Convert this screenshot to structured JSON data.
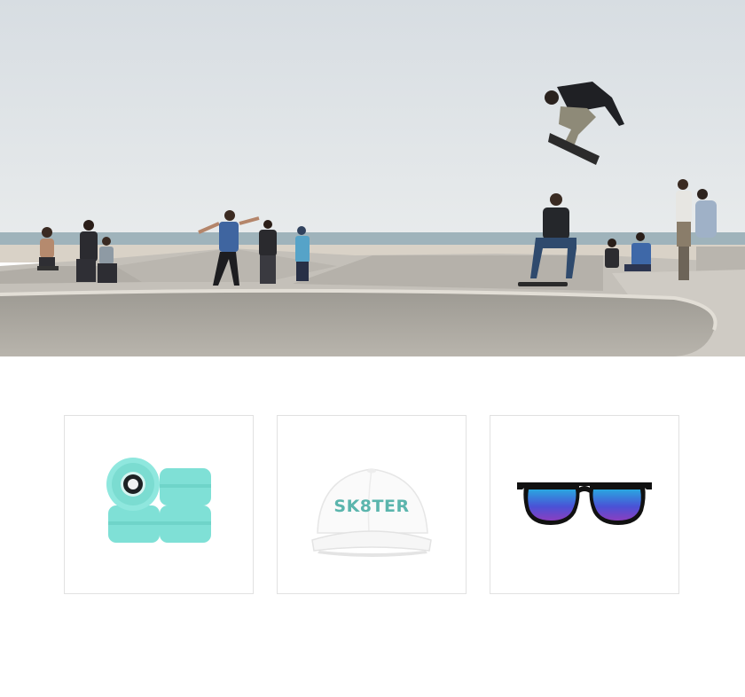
{
  "hero": {
    "scene": "skate-park-beach-scene",
    "colors": {
      "sky": "#dfe3e7",
      "ocean": "#9fb4bd",
      "sand": "#d8d1c6",
      "concrete": "#bdb9b2",
      "bowl": "#a9a59d"
    }
  },
  "products": [
    {
      "name": "wheels",
      "icon": "skate-wheels-icon",
      "color": "#7fe0d6"
    },
    {
      "name": "cap",
      "icon": "cap-icon",
      "logo_text": "SK8TER",
      "color": "#5bb5ad"
    },
    {
      "name": "sunglasses",
      "icon": "sunglasses-icon",
      "color": "#3e6fd8"
    }
  ]
}
